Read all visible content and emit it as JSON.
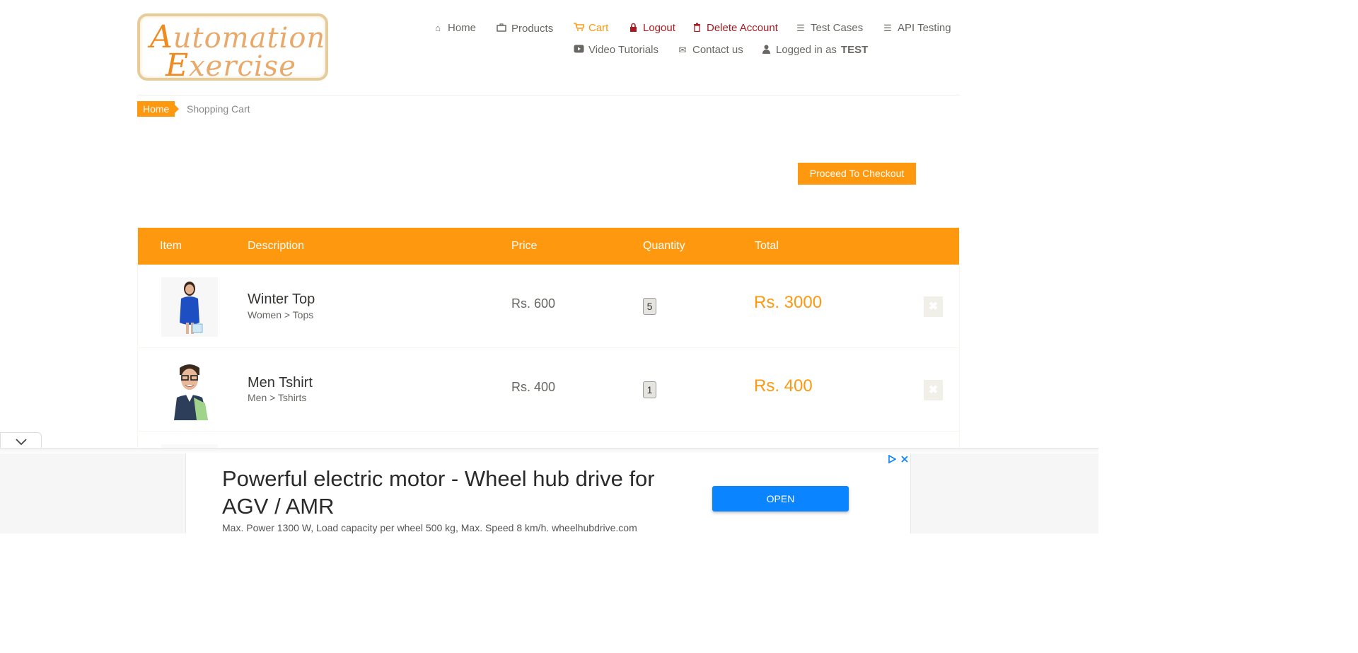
{
  "logo": {
    "line1_cap": "A",
    "line1_rest": "utomation",
    "line2_cap": "E",
    "line2_rest": "xercise"
  },
  "nav": {
    "home": "Home",
    "products": "Products",
    "cart": "Cart",
    "logout": "Logout",
    "delete_account": "Delete Account",
    "test_cases": "Test Cases",
    "api_testing": "API Testing",
    "video_tutorials": "Video Tutorials",
    "contact_us": "Contact us",
    "logged_in_prefix": "Logged in as",
    "username": "TEST"
  },
  "breadcrumb": {
    "home": "Home",
    "current": "Shopping Cart"
  },
  "checkout_button": "Proceed To Checkout",
  "cart_table": {
    "headers": {
      "item": "Item",
      "description": "Description",
      "price": "Price",
      "quantity": "Quantity",
      "total": "Total"
    },
    "rows": [
      {
        "name": "Winter Top",
        "category": "Women > Tops",
        "price": "Rs. 600",
        "quantity": "5",
        "total": "Rs. 3000",
        "delete": "✖"
      },
      {
        "name": "Men Tshirt",
        "category": "Men > Tshirts",
        "price": "Rs. 400",
        "quantity": "1",
        "total": "Rs. 400",
        "delete": "✖"
      }
    ]
  },
  "ad": {
    "title": "Powerful electric motor - Wheel hub drive for AGV / AMR",
    "description": "Max. Power 1300 W, Load capacity per wheel 500 kg, Max. Speed 8 km/h. wheelhubdrive.com",
    "open_button": "OPEN"
  },
  "colors": {
    "accent": "#fe980f",
    "danger": "#a71a21",
    "ad_button": "#0a84ff"
  }
}
